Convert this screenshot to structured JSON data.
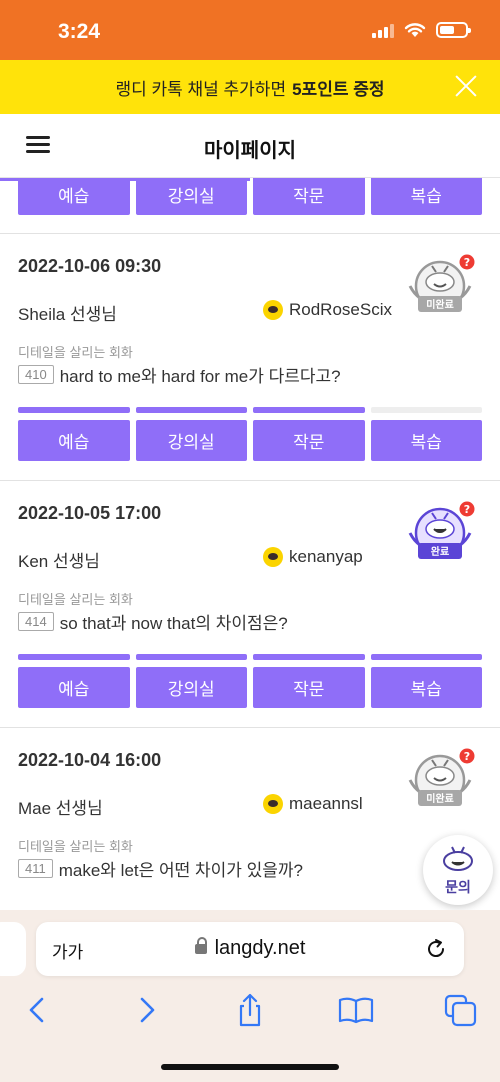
{
  "status": {
    "time": "3:24"
  },
  "banner": {
    "text": "랭디 카톡 채널 추가하면",
    "highlight": "5포인트 증정"
  },
  "header": {
    "title": "마이페이지"
  },
  "buttons": [
    "예습",
    "강의실",
    "작문",
    "복습"
  ],
  "lessons": [
    {
      "date": "2022-10-06 09:30",
      "teacher": "Sheila 선생님",
      "kakao_id": "RodRoseScix",
      "category": "디테일을 살리는 회화",
      "number": "410",
      "question": "hard to me와 hard for me가 다르다고?",
      "status": "미완료",
      "progress": [
        1,
        1,
        1,
        0
      ]
    },
    {
      "date": "2022-10-05 17:00",
      "teacher": "Ken 선생님",
      "kakao_id": "kenanyap",
      "category": "디테일을 살리는 회화",
      "number": "414",
      "question": "so that과 now that의 차이점은?",
      "status": "완료",
      "progress": [
        1,
        1,
        1,
        1
      ]
    },
    {
      "date": "2022-10-04 16:00",
      "teacher": "Mae 선생님",
      "kakao_id": "maeannsl",
      "category": "디테일을 살리는 회화",
      "number": "411",
      "question": "make와 let은 어떤 차이가 있을까?",
      "status": "미완료"
    }
  ],
  "float_button": {
    "label": "문의"
  },
  "browser": {
    "aa": "가가",
    "url": "langdy.net"
  },
  "colors": {
    "accent": "#8f6ef8",
    "banner": "#ffe30a",
    "statusbar": "#f07224"
  }
}
